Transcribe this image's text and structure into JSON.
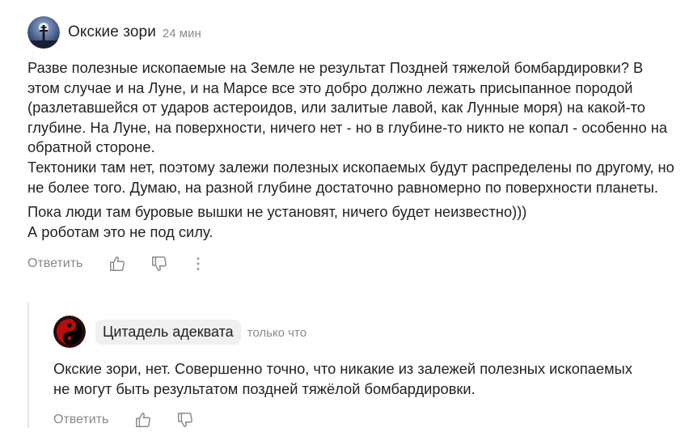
{
  "colors": {
    "text": "#222222",
    "muted": "#888888",
    "chip_bg": "#f0f0f0",
    "thread_line": "#e6e6e6"
  },
  "comment": {
    "author": "Окские зори",
    "time": "24 мин",
    "paragraphs": [
      "Разве полезные ископаемые на Земле не результат Поздней тяжелой бомбардировки? В этом случае и на Луне, и на Марсе все это добро должно лежать присыпанное породой (разлетавшейся от ударов астероидов, или залитые лавой, как Лунные моря) на какой-то глубине. На Луне, на поверхности, ничего нет - но в глубине-то никто не копал - особенно на обратной стороне.\nТектоники там нет, поэтому залежи полезных ископаемых будут распределены по другому, но не более того. Думаю, на разной глубине достаточно равномерно по поверхности планеты.",
      "Пока люди там буровые вышки не установят, ничего будет неизвестно)))\nА роботам это не под силу."
    ],
    "actions": {
      "reply_label": "Ответить",
      "like_icon": "thumbs-up-icon",
      "dislike_icon": "thumbs-down-icon",
      "more_icon": "more-vertical-icon"
    }
  },
  "reply": {
    "author": "Цитадель адеквата",
    "time": "только что",
    "text": "Окские зори, нет. Совершенно точно, что никакие из залежей полезных ископаемых не могут быть результатом поздней тяжёлой бомбардировки.",
    "actions": {
      "reply_label": "Ответить",
      "like_icon": "thumbs-up-icon",
      "dislike_icon": "thumbs-down-icon"
    }
  }
}
